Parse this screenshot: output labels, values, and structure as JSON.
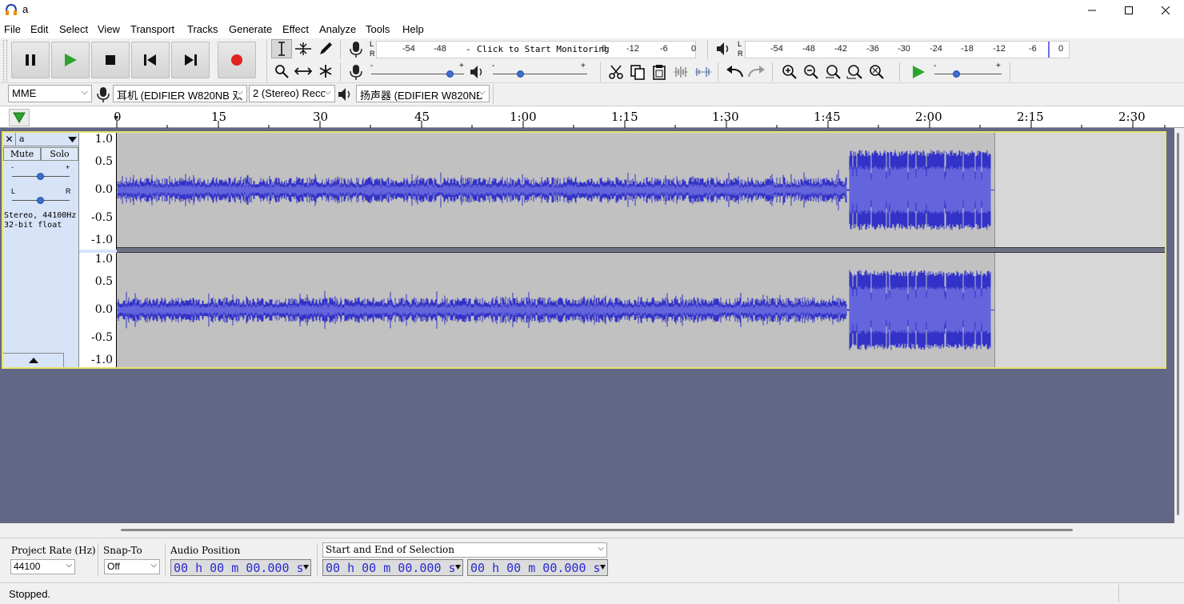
{
  "window": {
    "title": "a",
    "minimize_icon": "minimize-icon",
    "maximize_icon": "maximize-icon",
    "close_icon": "close-icon"
  },
  "menu": [
    "File",
    "Edit",
    "Select",
    "View",
    "Transport",
    "Tracks",
    "Generate",
    "Effect",
    "Analyze",
    "Tools",
    "Help"
  ],
  "record_meter": {
    "channels": [
      "L",
      "R"
    ],
    "scale": [
      "-54",
      "-48"
    ],
    "prompt": "Click to Start Monitoring",
    "scale_right": [
      "8",
      "-12",
      "-6",
      "0"
    ]
  },
  "playback_meter": {
    "channels": [
      "L",
      "R"
    ],
    "scale": [
      "-54",
      "-48",
      "-42",
      "-36",
      "-30",
      "-24",
      "-18",
      "-12",
      "-6",
      "0"
    ]
  },
  "slider_marks": {
    "minus": "-",
    "plus": "+"
  },
  "device": {
    "host": "MME",
    "recording_device": "耳机 (EDIFIER W820NB 双",
    "channels": "2 (Stereo) Reco",
    "playback_device": "扬声器 (EDIFIER W820NB"
  },
  "ruler": {
    "labels": [
      "0",
      "15",
      "30",
      "45",
      "1:00",
      "1:15",
      "1:30",
      "1:45",
      "2:00",
      "2:15",
      "2:30"
    ]
  },
  "track": {
    "name": "a",
    "mute": "Mute",
    "solo": "Solo",
    "gain_minus": "-",
    "gain_plus": "+",
    "pan_left": "L",
    "pan_right": "R",
    "info_line1": "Stereo, 44100Hz",
    "info_line2": "32-bit float",
    "close_label": "✕",
    "vscale": [
      "1.0",
      "0.5",
      "0.0",
      "-0.5",
      "-1.0"
    ],
    "wave_color": "#3232c8",
    "clip_color": "#c1c1c1"
  },
  "selection_toolbar": {
    "project_rate_label": "Project Rate (Hz)",
    "project_rate_value": "44100",
    "snap_label": "Snap-To",
    "snap_value": "Off",
    "audio_position_label": "Audio Position",
    "audio_position_value": "00 h 00 m 00.000 s",
    "selection_label": "Start and End of Selection",
    "selection_start": "00 h 00 m 00.000 s",
    "selection_end": "00 h 00 m 00.000 s"
  },
  "status": {
    "text": "Stopped."
  }
}
